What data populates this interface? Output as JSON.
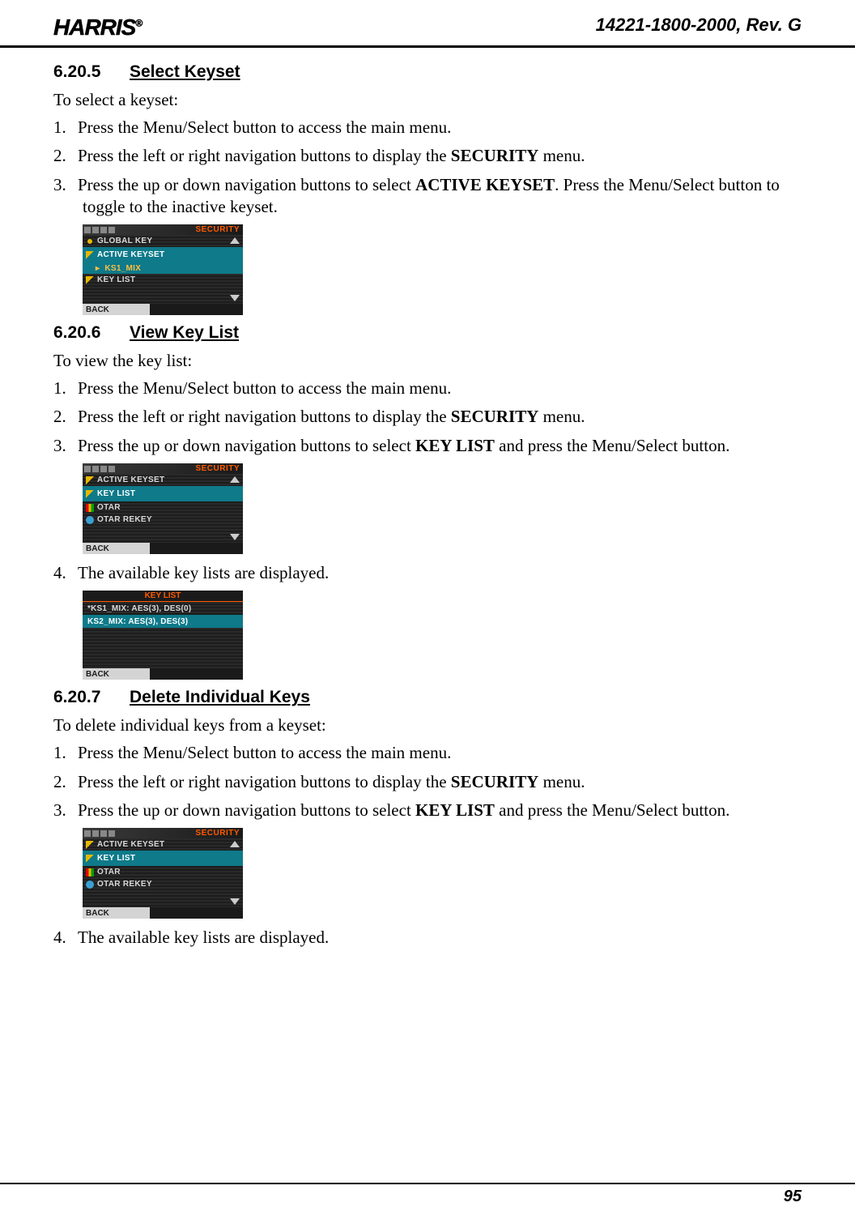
{
  "header": {
    "logo_text": "HARRIS",
    "doc_number": "14221-1800-2000, Rev. G"
  },
  "sections": {
    "s1": {
      "number": "6.20.5",
      "title": "Select Keyset",
      "intro": "To select a keyset:",
      "step1a": "Press the Menu/Select button to access the main menu.",
      "step2a": "Press the left or right navigation buttons to display the ",
      "step2b": "SECURITY",
      "step2c": " menu.",
      "step3a": "Press the up or down navigation buttons to select ",
      "step3b": "ACTIVE KEYSET",
      "step3c": ". Press the Menu/Select button to toggle to the inactive keyset."
    },
    "s2": {
      "number": "6.20.6",
      "title": "View Key List",
      "intro": "To view the key list:",
      "step1a": "Press the Menu/Select button to access the main menu.",
      "step2a": "Press the left or right navigation buttons to display the ",
      "step2b": "SECURITY",
      "step2c": " menu.",
      "step3a": "Press the up or down navigation buttons to select ",
      "step3b": "KEY LIST",
      "step3c": " and press the Menu/Select button.",
      "step4": "The available key lists are displayed."
    },
    "s3": {
      "number": "6.20.7",
      "title": "Delete Individual Keys",
      "intro": "To delete individual keys from a keyset:",
      "step1a": "Press the Menu/Select button to access the main menu.",
      "step2a": "Press the left or right navigation buttons to display the ",
      "step2b": "SECURITY",
      "step2c": " menu.",
      "step3a": "Press the up or down navigation buttons to select ",
      "step3b": "KEY LIST",
      "step3c": " and press the Menu/Select button.",
      "step4": "The available key lists are displayed."
    }
  },
  "screenshots": {
    "ss1": {
      "title": "SECURITY",
      "rows": {
        "r1": "GLOBAL KEY",
        "r2": "ACTIVE KEYSET",
        "sub": "KS1_MIX",
        "r3": "KEY LIST"
      },
      "back": "BACK"
    },
    "ss2": {
      "title": "SECURITY",
      "rows": {
        "r1": "ACTIVE KEYSET",
        "r2": "KEY LIST",
        "r3": "OTAR",
        "r4": "OTAR REKEY"
      },
      "back": "BACK"
    },
    "ss3": {
      "title": "KEY LIST",
      "rows": {
        "r1": "*KS1_MIX: AES(3), DES(0)",
        "r2": "KS2_MIX: AES(3), DES(3)"
      },
      "back": "BACK"
    },
    "ss4": {
      "title": "SECURITY",
      "rows": {
        "r1": "ACTIVE KEYSET",
        "r2": "KEY LIST",
        "r3": "OTAR",
        "r4": "OTAR REKEY"
      },
      "back": "BACK"
    }
  },
  "footer": {
    "page_number": "95"
  }
}
